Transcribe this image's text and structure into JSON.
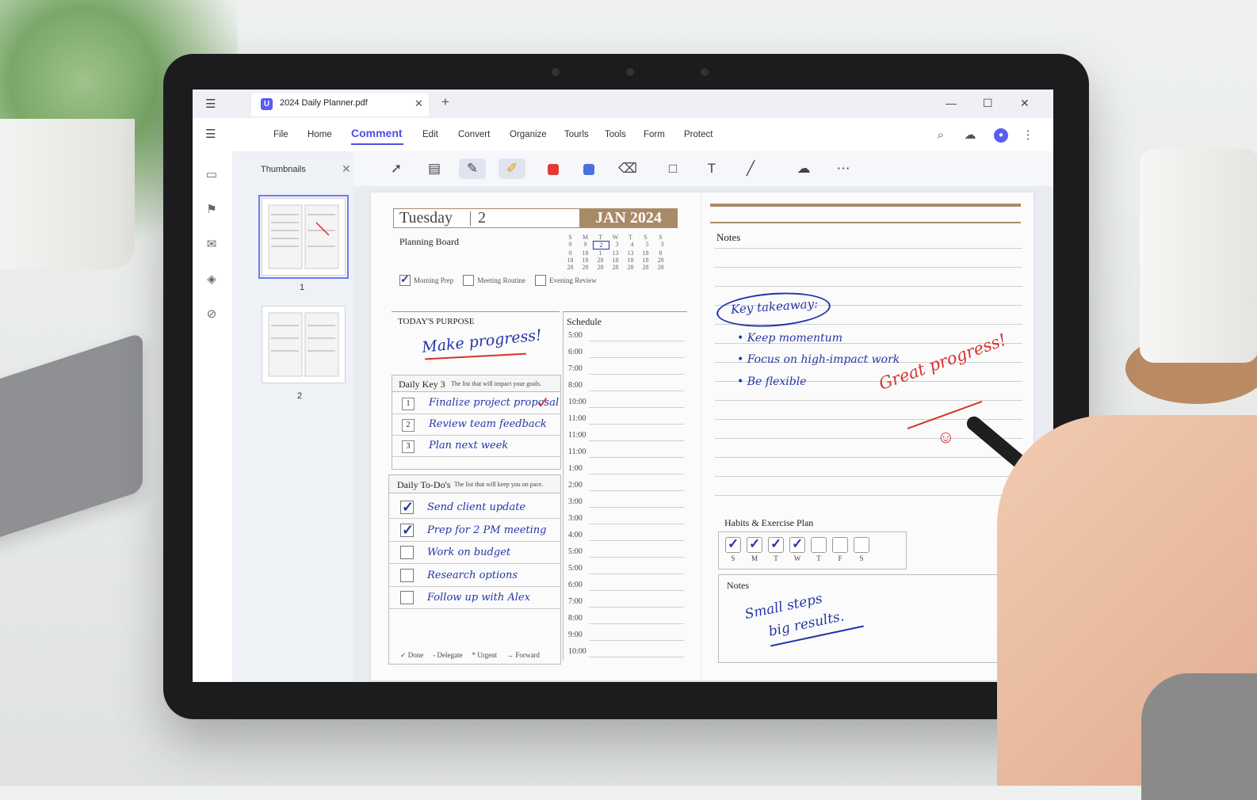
{
  "tab": {
    "title": "2024 Daily Planner.pdf"
  },
  "menu": {
    "items": [
      "File",
      "Home",
      "Comment",
      "Edit",
      "Convert",
      "Organize",
      "Tourls",
      "Tools",
      "Form",
      "Protect"
    ],
    "active": "Comment"
  },
  "thumbnails": {
    "title": "Thumbnails",
    "pages": [
      "1",
      "2"
    ]
  },
  "planner": {
    "day": "Tuesday",
    "date": "2",
    "month_year": "JAN 2024",
    "planning_board": "Planning Board",
    "calendar_head": [
      "S",
      "M",
      "T",
      "W",
      "T",
      "S",
      "S"
    ],
    "calendar_rows": [
      [
        "9",
        "9",
        "2",
        "3",
        "4",
        "5",
        "3"
      ],
      [
        "0",
        "18",
        "1",
        "13",
        "13",
        "18",
        "8"
      ],
      [
        "18",
        "18",
        "28",
        "18",
        "18",
        "18",
        "28"
      ],
      [
        "28",
        "28",
        "28",
        "28",
        "28",
        "28",
        "28"
      ]
    ],
    "routines": [
      {
        "label": "Morning Prep",
        "checked": true
      },
      {
        "label": "Meeting Routine",
        "checked": false
      },
      {
        "label": "Evening Review",
        "checked": false
      }
    ],
    "purpose_title": "TODAY'S PURPOSE",
    "purpose_text": "Make progress!",
    "key3_title": "Daily Key 3",
    "key3_sub": "The list that will impact your goals.",
    "key3": [
      {
        "num": "1",
        "text": "Finalize project proposal",
        "done": true
      },
      {
        "num": "2",
        "text": "Review team feedback",
        "done": false
      },
      {
        "num": "3",
        "text": "Plan next week",
        "done": false
      }
    ],
    "todo_title": "Daily To-Do's",
    "todo_sub": "The list that will keep you on pace.",
    "todos": [
      {
        "text": "Send client update",
        "checked": true
      },
      {
        "text": "Prep for 2 PM meeting",
        "checked": true
      },
      {
        "text": "Work on budget",
        "checked": false
      },
      {
        "text": "Research options",
        "checked": false
      },
      {
        "text": "Follow up with Alex",
        "checked": false
      }
    ],
    "legend": [
      "✓ Done",
      "- Delegate",
      "* Urgent",
      "→ Forward"
    ],
    "schedule_title": "Schedule",
    "schedule": [
      "5:00",
      "6:00",
      "7:00",
      "8:00",
      "10:00",
      "11:00",
      "11:00",
      "11:00",
      "1:00",
      "2:00",
      "3:00",
      "3:00",
      "4:00",
      "5:00",
      "5:00",
      "6:00",
      "7:00",
      "8:00",
      "9:00",
      "10:00"
    ],
    "notes_title": "Notes",
    "key_takeaway": "Key takeaway:",
    "bullets": [
      "• Keep momentum",
      "• Focus on high-impact work",
      "• Be flexible"
    ],
    "great_progress": "Great progress!",
    "smiley": "☺",
    "habits_title": "Habits & Exercise Plan",
    "habit_days": [
      {
        "d": "S",
        "checked": true
      },
      {
        "d": "M",
        "checked": true
      },
      {
        "d": "T",
        "checked": true
      },
      {
        "d": "W",
        "checked": true
      },
      {
        "d": "T",
        "checked": false
      },
      {
        "d": "F",
        "checked": false
      },
      {
        "d": "S",
        "checked": false
      }
    ],
    "notes2_title": "Notes",
    "notes2_line1": "Small steps",
    "notes2_line2": "big results."
  },
  "colors": {
    "accent": "#4c50e6",
    "planner_header": "#a98a67",
    "ink_blue": "#2336a8",
    "ink_red": "#d8312c"
  }
}
